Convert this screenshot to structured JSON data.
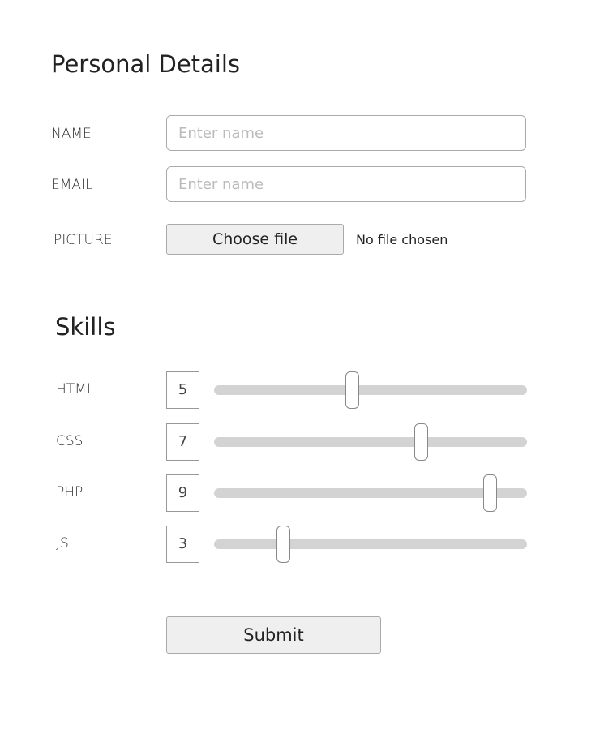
{
  "personal": {
    "title": "Personal Details",
    "name": {
      "label": "NAME",
      "placeholder": "Enter name"
    },
    "email": {
      "label": "EMAIL",
      "placeholder": "Enter name"
    },
    "picture": {
      "label": "PICTURE",
      "button": "Choose file",
      "status": "No file chosen"
    }
  },
  "skills": {
    "title": "Skills",
    "min": 1,
    "max": 10,
    "items": [
      {
        "label": "HTML",
        "value": "5"
      },
      {
        "label": "CSS",
        "value": "7"
      },
      {
        "label": "PHP",
        "value": "9"
      },
      {
        "label": "JS",
        "value": "3"
      }
    ]
  },
  "submit_label": "Submit"
}
